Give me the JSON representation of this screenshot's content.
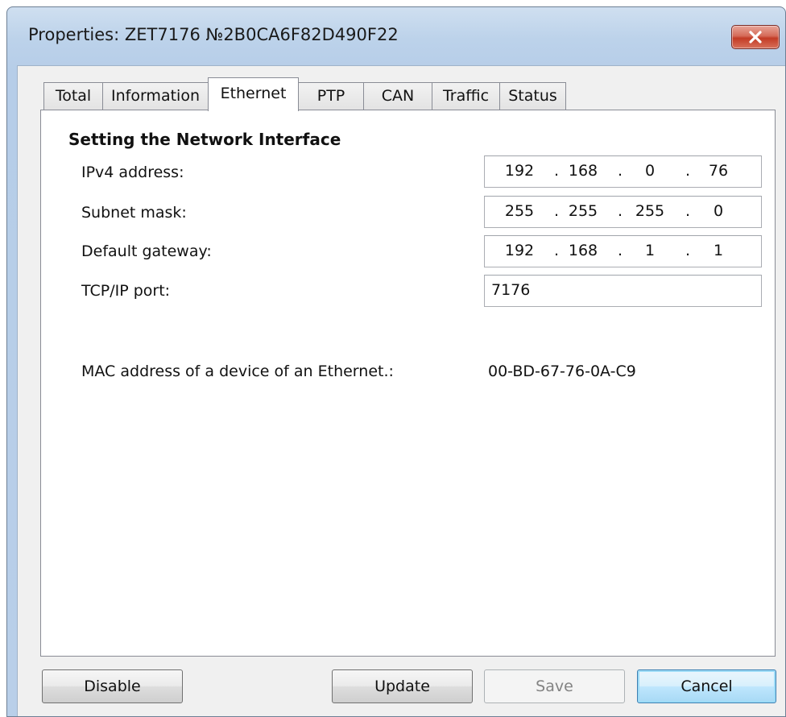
{
  "window": {
    "title": "Properties: ZET7176 №2B0CA6F82D490F22",
    "close_icon": "close-x-icon",
    "close_color": "#c23b25"
  },
  "tabs": [
    {
      "label": "Total",
      "active": false
    },
    {
      "label": "Information",
      "active": false
    },
    {
      "label": "Ethernet",
      "active": true
    },
    {
      "label": "PTP",
      "active": false
    },
    {
      "label": "CAN",
      "active": false
    },
    {
      "label": "Traffic",
      "active": false
    },
    {
      "label": "Status",
      "active": false
    }
  ],
  "network": {
    "section_title": "Setting the Network Interface",
    "ipv4": {
      "label": "IPv4 address:",
      "octets": [
        "192",
        "168",
        "0",
        "76"
      ]
    },
    "subnet": {
      "label": "Subnet mask:",
      "octets": [
        "255",
        "255",
        "255",
        "0"
      ]
    },
    "gateway": {
      "label": "Default gateway:",
      "octets": [
        "192",
        "168",
        "1",
        "1"
      ]
    },
    "port": {
      "label": "TCP/IP port:",
      "value": "7176"
    },
    "mac": {
      "label": "MAC address of a device of an Ethernet.:",
      "value": "00-BD-67-76-0A-C9"
    },
    "separator": "."
  },
  "buttons": {
    "disable": {
      "label": "Disable",
      "enabled": true
    },
    "update": {
      "label": "Update",
      "enabled": true
    },
    "save": {
      "label": "Save",
      "enabled": false
    },
    "cancel": {
      "label": "Cancel",
      "enabled": true,
      "default": true
    }
  }
}
